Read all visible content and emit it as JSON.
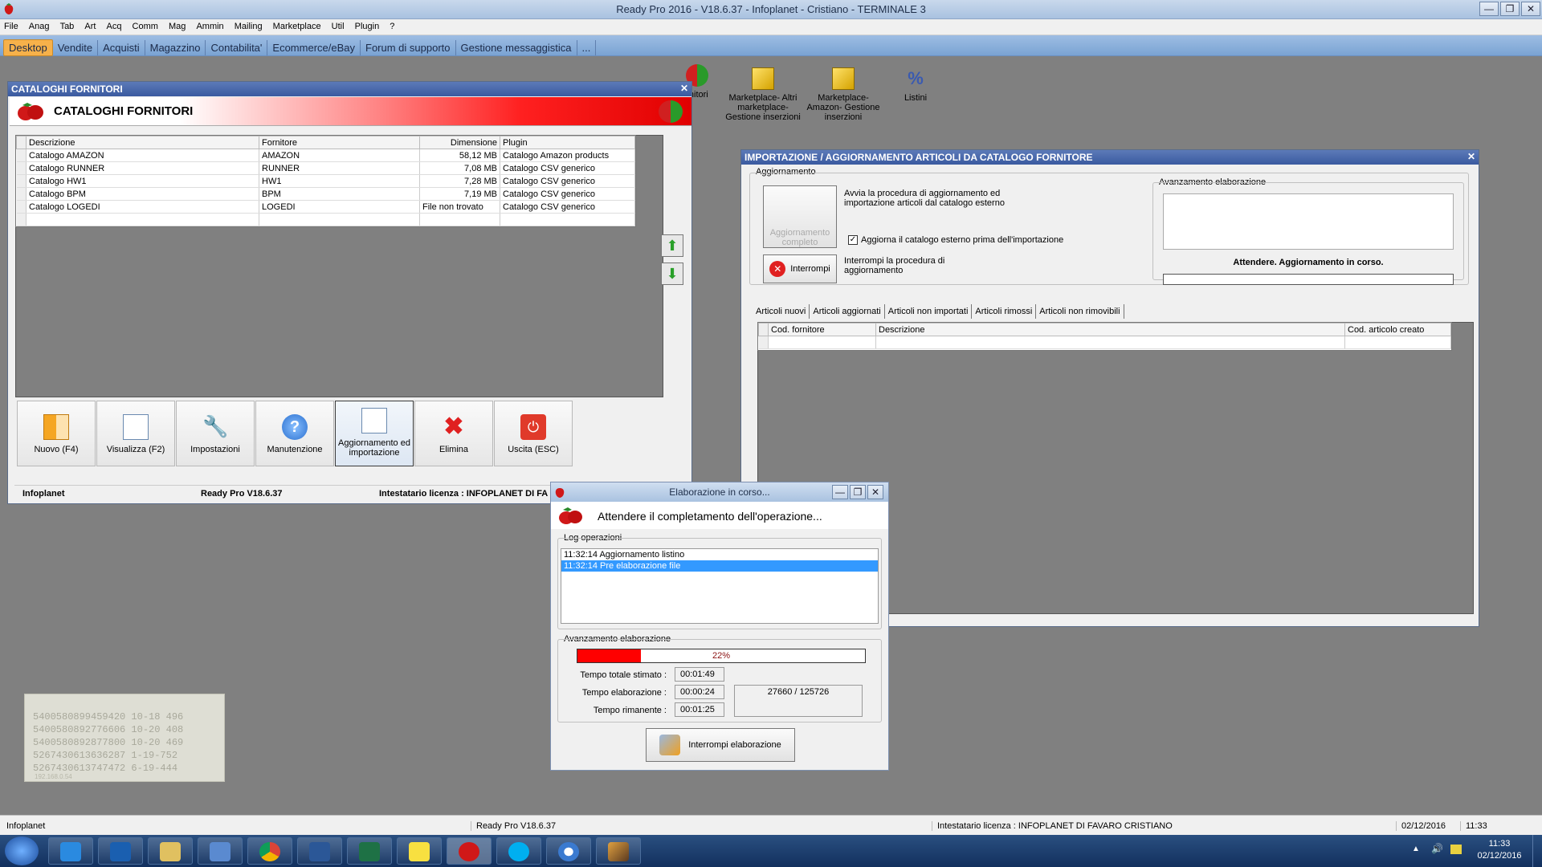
{
  "app": {
    "title": "Ready Pro 2016 - V18.6.37 - Infoplanet - Cristiano - TERMINALE 3",
    "window_buttons": [
      "—",
      "❐",
      "✕"
    ]
  },
  "menu": [
    "File",
    "Anag",
    "Tab",
    "Art",
    "Acq",
    "Comm",
    "Mag",
    "Ammin",
    "Mailing",
    "Marketplace",
    "Util",
    "Plugin",
    "?"
  ],
  "tabs": [
    "Desktop",
    "Vendite",
    "Acquisti",
    "Magazzino",
    "Contabilita'",
    "Ecommerce/eBay",
    "Forum di supporto",
    "Gestione messaggistica",
    "..."
  ],
  "desktop_icons": {
    "fornitori_fragment": "rnitori",
    "marketplace_altri": [
      "Marketplace- Altri",
      "marketplace-",
      "Gestione inserzioni"
    ],
    "marketplace_amazon": [
      "Marketplace-",
      "Amazon- Gestione",
      "inserzioni"
    ],
    "listini": "Listini"
  },
  "cataloghi": {
    "window_title": "CATALOGHI FORNITORI",
    "header_title": "CATALOGHI FORNITORI",
    "columns": [
      "Descrizione",
      "Fornitore",
      "Dimensione",
      "Plugin"
    ],
    "rows": [
      [
        "Catalogo AMAZON",
        "AMAZON",
        "58,12 MB",
        "Catalogo Amazon products"
      ],
      [
        "Catalogo RUNNER",
        "RUNNER",
        "7,08 MB",
        "Catalogo CSV generico"
      ],
      [
        "Catalogo HW1",
        "HW1",
        "7,28 MB",
        "Catalogo CSV generico"
      ],
      [
        "Catalogo BPM",
        "BPM",
        "7,19 MB",
        "Catalogo CSV generico"
      ],
      [
        "Catalogo LOGEDI",
        "LOGEDI",
        "File non trovato",
        "Catalogo CSV generico"
      ]
    ],
    "buttons": [
      "Nuovo (F4)",
      "Visualizza (F2)",
      "Impostazioni",
      "Manutenzione",
      "Aggiornamento ed importazione",
      "Elimina",
      "Uscita (ESC)"
    ],
    "status": [
      "Infoplanet",
      "Ready Pro V18.6.37",
      "Intestatario licenza : INFOPLANET DI FA"
    ]
  },
  "importazione": {
    "window_title": "IMPORTAZIONE / AGGIORNAMENTO ARTICOLI DA CATALOGO FORNITORE",
    "aggiornamento_label": "Aggiornamento",
    "aggiornamento_completo": "Aggiornamento completo",
    "avvia_text": "Avvia la procedura di aggiornamento ed importazione articoli dal catalogo esterno",
    "checkbox_label": "Aggiorna il catalogo esterno prima dell'importazione",
    "interrompi_btn": "Interrompi",
    "interrompi_text": "Interrompi la procedura di aggiornamento",
    "avanzamento_label": "Avanzamento elaborazione",
    "attendere": "Attendere. Aggiornamento in corso.",
    "subtabs": [
      "Articoli nuovi",
      "Articoli aggiornati",
      "Articoli non importati",
      "Articoli rimossi",
      "Articoli non rimovibili"
    ],
    "columns": [
      "Cod. fornitore",
      "Descrizione",
      "Cod. articolo creato"
    ]
  },
  "elaborazione": {
    "window_title": "Elaborazione in corso...",
    "header": "Attendere il completamento dell'operazione...",
    "log_label": "Log operazioni",
    "log": [
      "11:32:14 Aggiornamento listino",
      "11:32:14 Pre elaborazione file"
    ],
    "avanzamento_label": "Avanzamento elaborazione",
    "progress_text": "22%",
    "progress": 0.22,
    "tempo_totale_label": "Tempo totale stimato :",
    "tempo_totale": "00:01:49",
    "tempo_elab_label": "Tempo elaborazione :",
    "tempo_elab": "00:00:24",
    "tempo_rim_label": "Tempo rimanente :",
    "tempo_rim": "00:01:25",
    "counter": "27660 / 125726",
    "stop_btn": "Interrompi elaborazione"
  },
  "widget": {
    "lines": [
      "5400580899459420   10-18  496",
      "5400580892776606   10-20  408",
      "5400580892877800  10-20  469",
      "5267430613636287   1-19-752",
      "5267430613747472   6-19-444"
    ],
    "ip": "192.168.0.54"
  },
  "statusbar": {
    "left": "Infoplanet",
    "mid": "Ready Pro V18.6.37",
    "licenza": "Intestatario licenza : INFOPLANET DI FAVARO CRISTIANO",
    "date": "02/12/2016",
    "time": "11:33"
  },
  "taskbar": {
    "apps": [
      "internet-explorer-icon",
      "outlook-icon",
      "explorer-icon",
      "network-icon",
      "chrome-icon",
      "word-icon",
      "excel-icon",
      "sticky-notes-icon",
      "readypro-icon",
      "skype-icon",
      "radiation-icon",
      "paint-icon"
    ],
    "clock_time": "11:33",
    "clock_date": "02/12/2016"
  },
  "colors": {
    "accent": "#ff0000",
    "selection": "#3399ff",
    "tab_active": "#f7b14a"
  }
}
